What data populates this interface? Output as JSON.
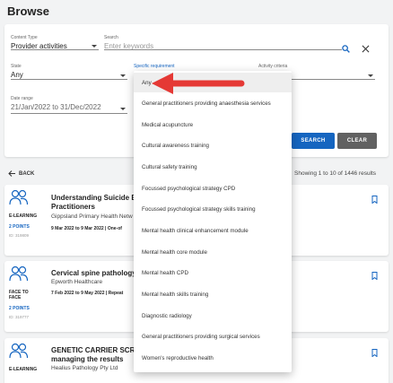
{
  "page": {
    "title": "Browse"
  },
  "filters": {
    "content_type": {
      "label": "Content Type",
      "value": "Provider activities"
    },
    "search": {
      "label": "Search",
      "placeholder": "Enter keywords"
    },
    "state": {
      "label": "State",
      "value": "Any"
    },
    "specific_requirement": {
      "label": "Specific requirement"
    },
    "activity_criteria": {
      "label": "Activity criteria"
    },
    "date_range": {
      "label": "Date range",
      "value": "21/Jan/2022 to 31/Dec/2022"
    },
    "search_button": "SEARCH",
    "clear_button": "CLEAR"
  },
  "results": {
    "back_label": "BACK",
    "count_text": "Showing 1 to 10 of 1446 results",
    "items": [
      {
        "type": "E-LEARNING",
        "points": "2 POINTS",
        "id": "ID: 319809",
        "title_line1": "Understanding Suicide B",
        "title_line2": "Practitioners",
        "provider": "Gippsland Primary Health Netw",
        "dates": "9 Mar 2022 to 9 Mar 2022 | One-of"
      },
      {
        "type": "FACE TO FACE",
        "points": "2 POINTS",
        "id": "ID: 319777",
        "title_line1": "Cervical spine pathology",
        "provider": "Epworth Healthcare",
        "dates": "7 Feb 2022 to 9 May 2022 | Repeat"
      },
      {
        "type": "E-LEARNING",
        "title_line1": "GENETIC CARRIER SCRE",
        "title_line2": "managing the results",
        "provider": "Healius Pathology Pty Ltd"
      }
    ]
  },
  "dropdown": {
    "options": [
      "Any",
      "General practitioners providing anaesthesia services",
      "Medical acupuncture",
      "Cultural awareness training",
      "Cultural safety training",
      "Focussed psychological strategy CPD",
      "Focussed psychological strategy skills training",
      "Mental health clinical enhancement module",
      "Mental health core module",
      "Mental health CPD",
      "Mental health skills training",
      "Diagnostic radiology",
      "General practitioners providing surgical services",
      "Women's reproductive health"
    ]
  },
  "colors": {
    "accent": "#1565c0",
    "clear": "#616161",
    "annotation_arrow": "#e53935"
  }
}
